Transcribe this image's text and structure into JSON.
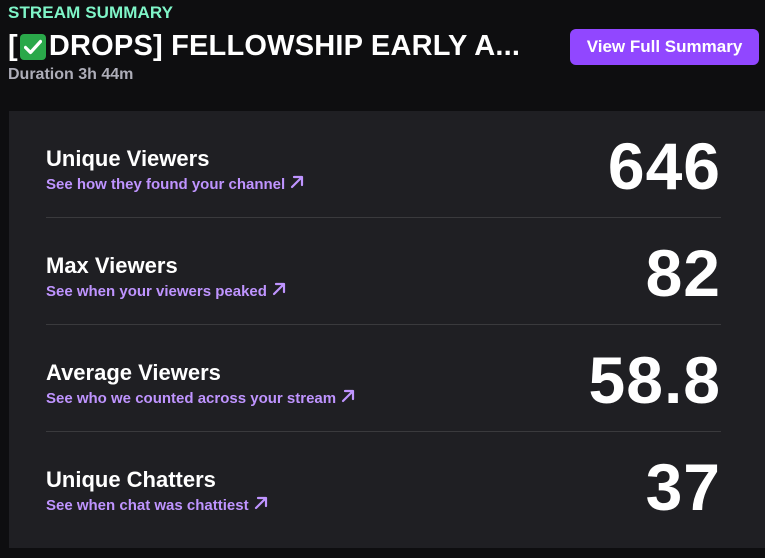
{
  "header": {
    "section_label": "STREAM SUMMARY",
    "title_prefix": "[",
    "title_suffix": "DROPS] FELLOWSHIP EARLY A...",
    "title_emoji": "white-check-mark",
    "duration": "Duration 3h 44m",
    "view_button_label": "View Full Summary"
  },
  "stats": [
    {
      "title": "Unique Viewers",
      "link": "See how they found your channel",
      "value": "646"
    },
    {
      "title": "Max Viewers",
      "link": "See when your viewers peaked",
      "value": "82"
    },
    {
      "title": "Average Viewers",
      "link": "See who we counted across your stream",
      "value": "58.8"
    },
    {
      "title": "Unique Chatters",
      "link": "See when chat was chattiest",
      "value": "37"
    }
  ],
  "colors": {
    "accent": "#9147ff",
    "link": "#bf94ff",
    "label": "#7ff5c8",
    "background": "#0e0e10",
    "panel": "#1f1f23"
  },
  "icons": {
    "link_arrow": "arrow-up-right-icon"
  }
}
